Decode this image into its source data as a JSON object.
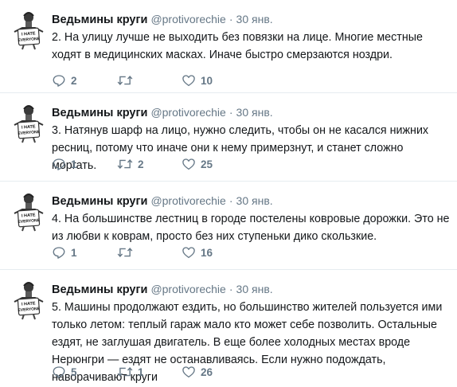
{
  "author": {
    "name": "Ведьмины круги",
    "handle": "@protivorechie",
    "date": "30 янв.",
    "separator": "·",
    "avatar_text_line1": "I HATE",
    "avatar_text_line2": "EVERYONE"
  },
  "icons": {
    "reply": "reply-icon",
    "retweet": "retweet-icon",
    "like": "heart-icon"
  },
  "tweets": [
    {
      "text": "2. На улицу лучше не выходить без повязки на лице. Многие местные ходят в медицинских масках. Иначе быстро смерзаются ноздри.",
      "replies": "2",
      "retweets": "",
      "likes": "10"
    },
    {
      "text": "3. Натянув шарф на лицо, нужно следить, чтобы он не касался нижних ресниц, потому что иначе они к нему примерзнут, и станет сложно моргать.",
      "replies": "1",
      "retweets": "2",
      "likes": "25"
    },
    {
      "text": "4. На большинстве лестниц в городе постелены ковровые дорожки. Это не из любви к коврам, просто без них ступеньки дико скользкие.",
      "replies": "1",
      "retweets": "",
      "likes": "16"
    },
    {
      "text": "5. Машины продолжают ездить, но большинство жителей пользуется  ими только летом: теплый гараж мало кто может себе позволить. Остальные ездят, не заглушая двигатель. В еще более холодных местах вроде Нерюнгри — ездят не останавливаясь. Если нужно подождать, наворачивают круги",
      "replies": "5",
      "retweets": "1",
      "likes": "26"
    }
  ],
  "colors": {
    "text": "#14171a",
    "muted": "#657786",
    "divider": "#e6ecf0"
  }
}
